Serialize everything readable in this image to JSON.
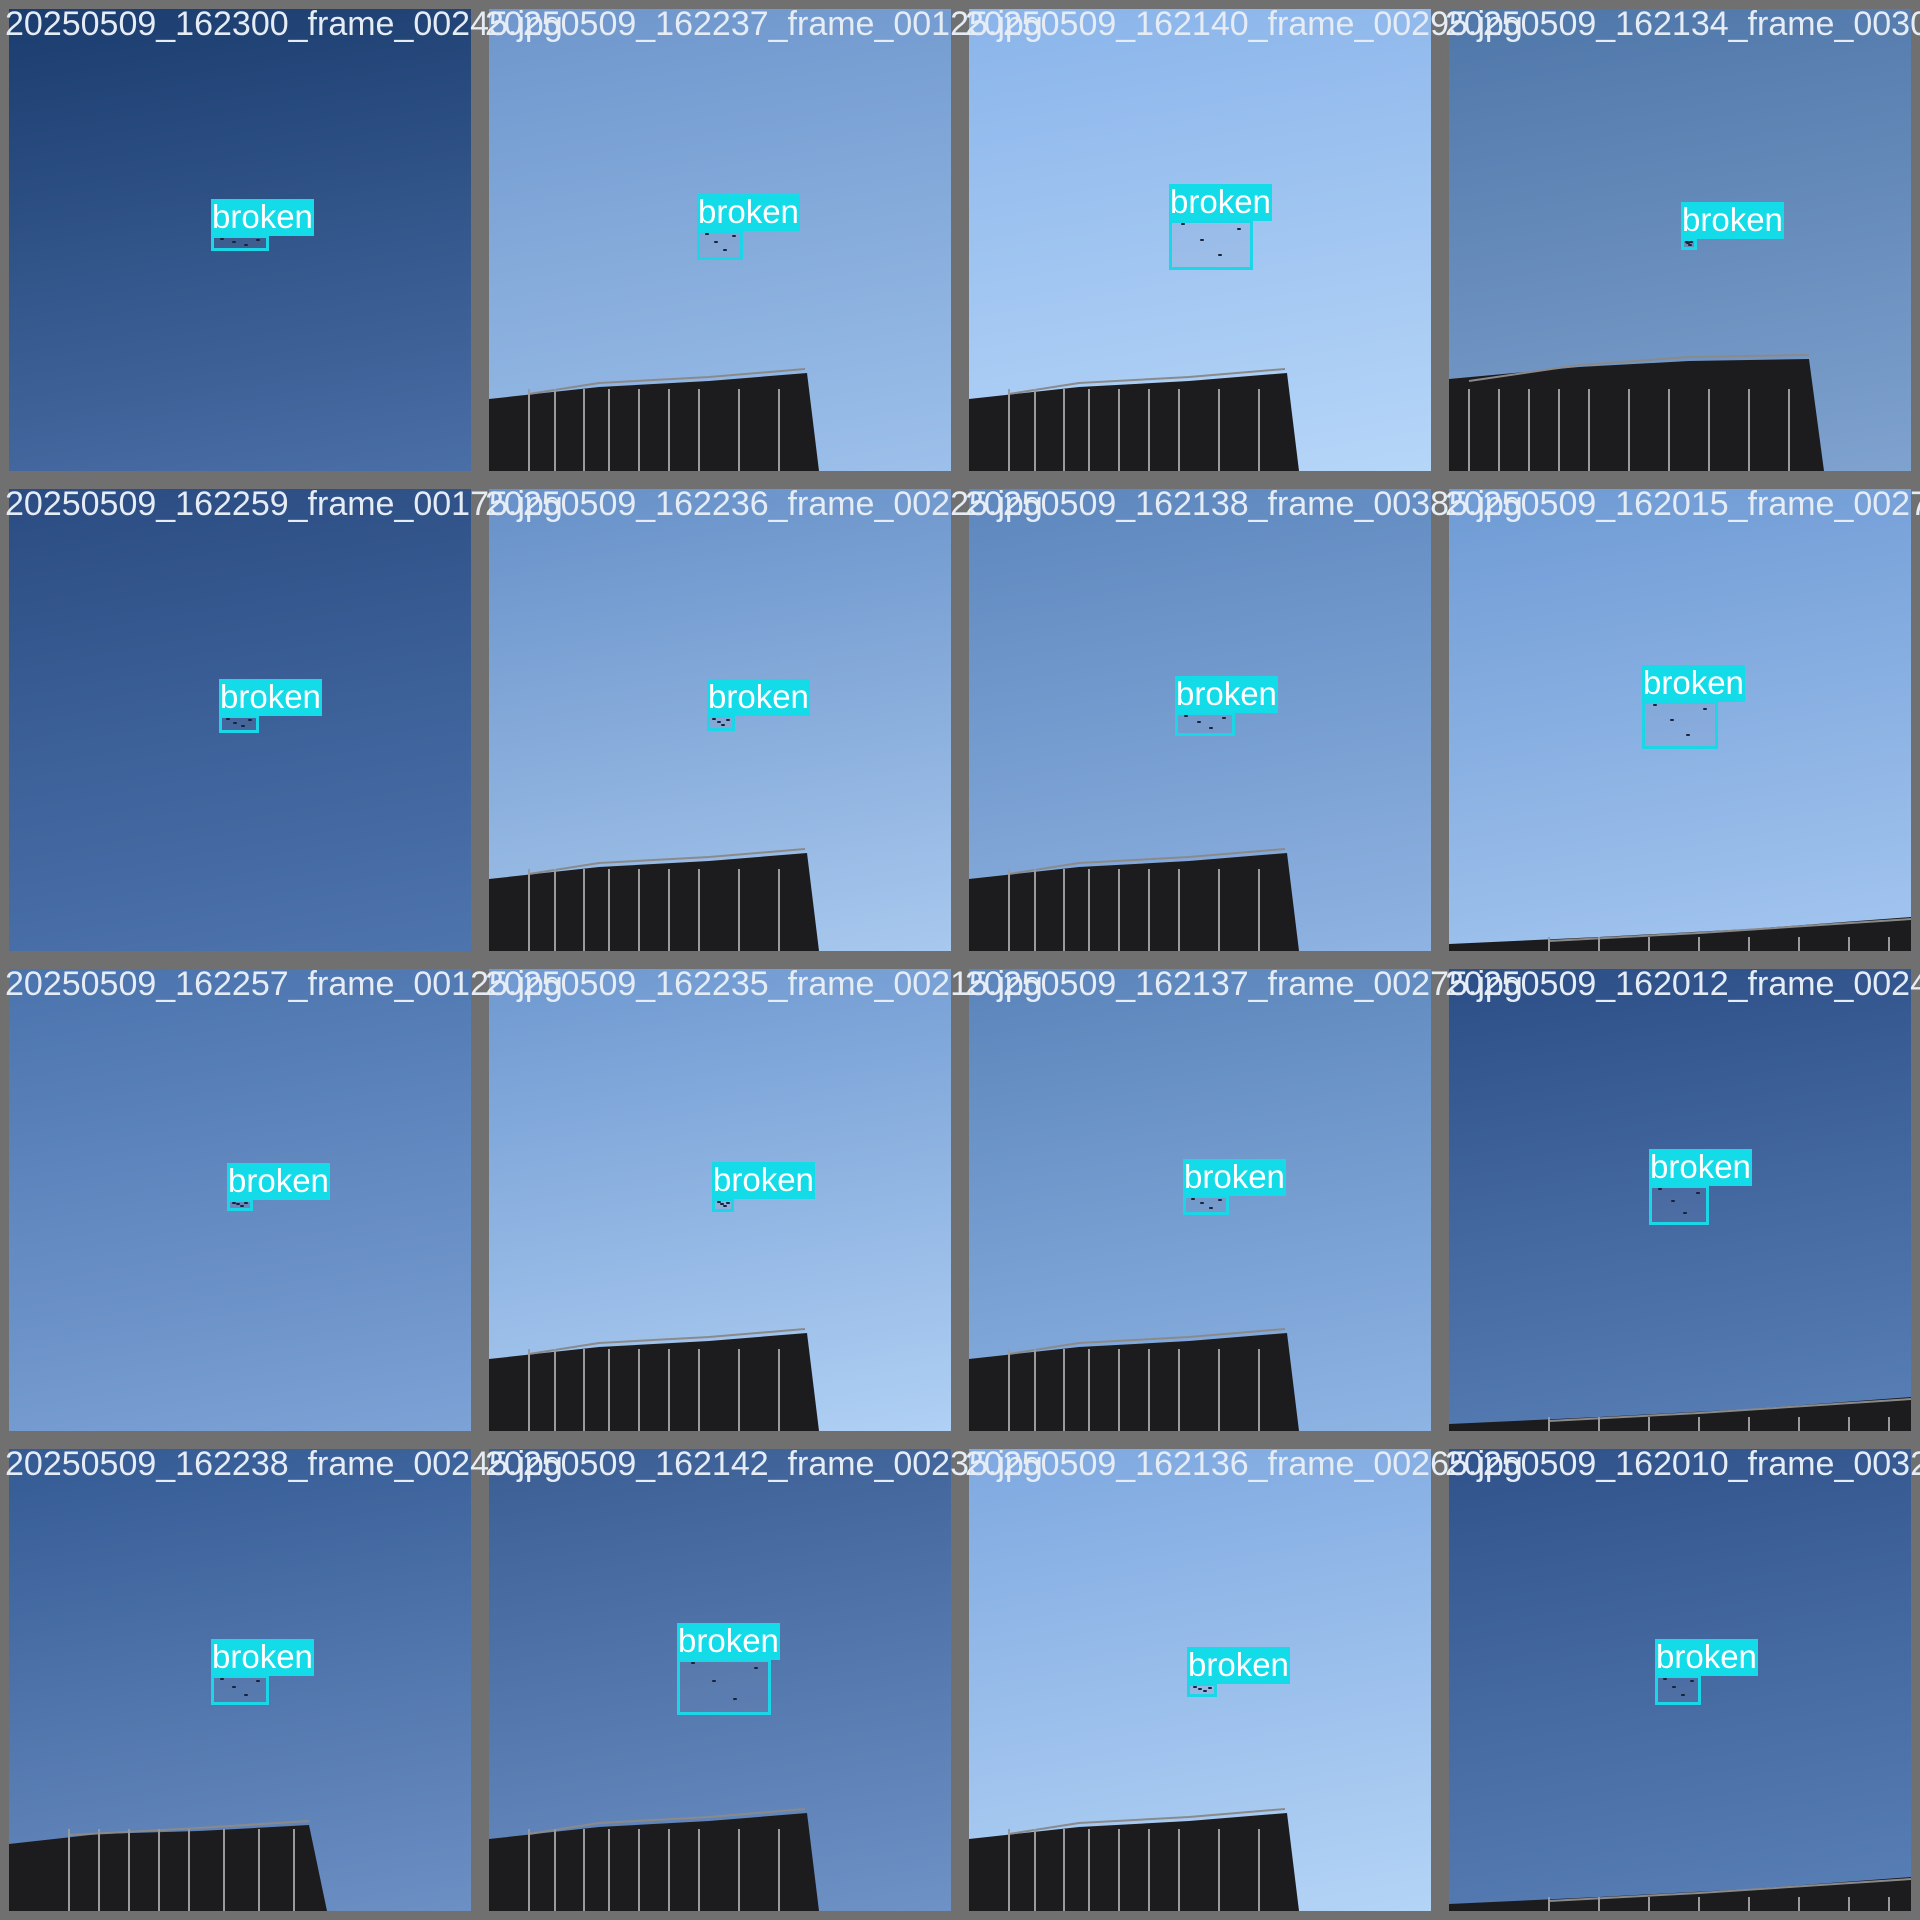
{
  "tiles": [
    {
      "filename": "20250509_162300_frame_00245.jpg",
      "label": "broken",
      "sky": [
        "#1a3c6e",
        "#4a6ea6"
      ],
      "building": "none"
    },
    {
      "filename": "20250509_162237_frame_00125.jpg",
      "label": "broken",
      "sky": [
        "#6e96cc",
        "#9cc0ea"
      ],
      "building": "right"
    },
    {
      "filename": "20250509_162140_frame_00295.jpg",
      "label": "broken",
      "sky": [
        "#8ab4ea",
        "#b6d6f8"
      ],
      "building": "right"
    },
    {
      "filename": "20250509_162134_frame_00305.jpg",
      "label": "broken",
      "sky": [
        "#4e76a8",
        "#7fa2cf"
      ],
      "building": "full"
    },
    {
      "filename": "20250509_162259_frame_00175.jpg",
      "label": "broken",
      "sky": [
        "#2a4c82",
        "#4e74ae"
      ],
      "building": "none"
    },
    {
      "filename": "20250509_162236_frame_00225.jpg",
      "label": "broken",
      "sky": [
        "#6690c8",
        "#a8c8ee"
      ],
      "building": "right"
    },
    {
      "filename": "20250509_162138_frame_00385.jpg",
      "label": "broken",
      "sky": [
        "#5c86bd",
        "#8fb3e2"
      ],
      "building": "right"
    },
    {
      "filename": "20250509_162015_frame_00275.jpg",
      "label": "broken",
      "sky": [
        "#6e9ad4",
        "#a4c6f0"
      ],
      "building": "low"
    },
    {
      "filename": "20250509_162257_frame_00125.jpg",
      "label": "broken",
      "sky": [
        "#4a72ac",
        "#7ca2d6"
      ],
      "building": "none"
    },
    {
      "filename": "20250509_162235_frame_00215.jpg",
      "label": "broken",
      "sky": [
        "#6e98d0",
        "#b0d0f4"
      ],
      "building": "right"
    },
    {
      "filename": "20250509_162137_frame_00275.jpg",
      "label": "broken",
      "sky": [
        "#5a84ba",
        "#8eb4e4"
      ],
      "building": "right"
    },
    {
      "filename": "20250509_162012_frame_00245.jpg",
      "label": "broken",
      "sky": [
        "#2c4e86",
        "#5a80b8"
      ],
      "building": "low"
    },
    {
      "filename": "20250509_162238_frame_00245.jpg",
      "label": "broken",
      "sky": [
        "#345a94",
        "#6c90c4"
      ],
      "building": "left"
    },
    {
      "filename": "20250509_162142_frame_00235.jpg",
      "label": "broken",
      "sky": [
        "#3a5e94",
        "#6e92c6"
      ],
      "building": "right"
    },
    {
      "filename": "20250509_162136_frame_00265.jpg",
      "label": "broken",
      "sky": [
        "#7ea8e0",
        "#b4d4f6"
      ],
      "building": "right"
    },
    {
      "filename": "20250509_162010_frame_00325.jpg",
      "label": "broken",
      "sky": [
        "#30528a",
        "#5a80b8"
      ],
      "building": "low"
    }
  ]
}
